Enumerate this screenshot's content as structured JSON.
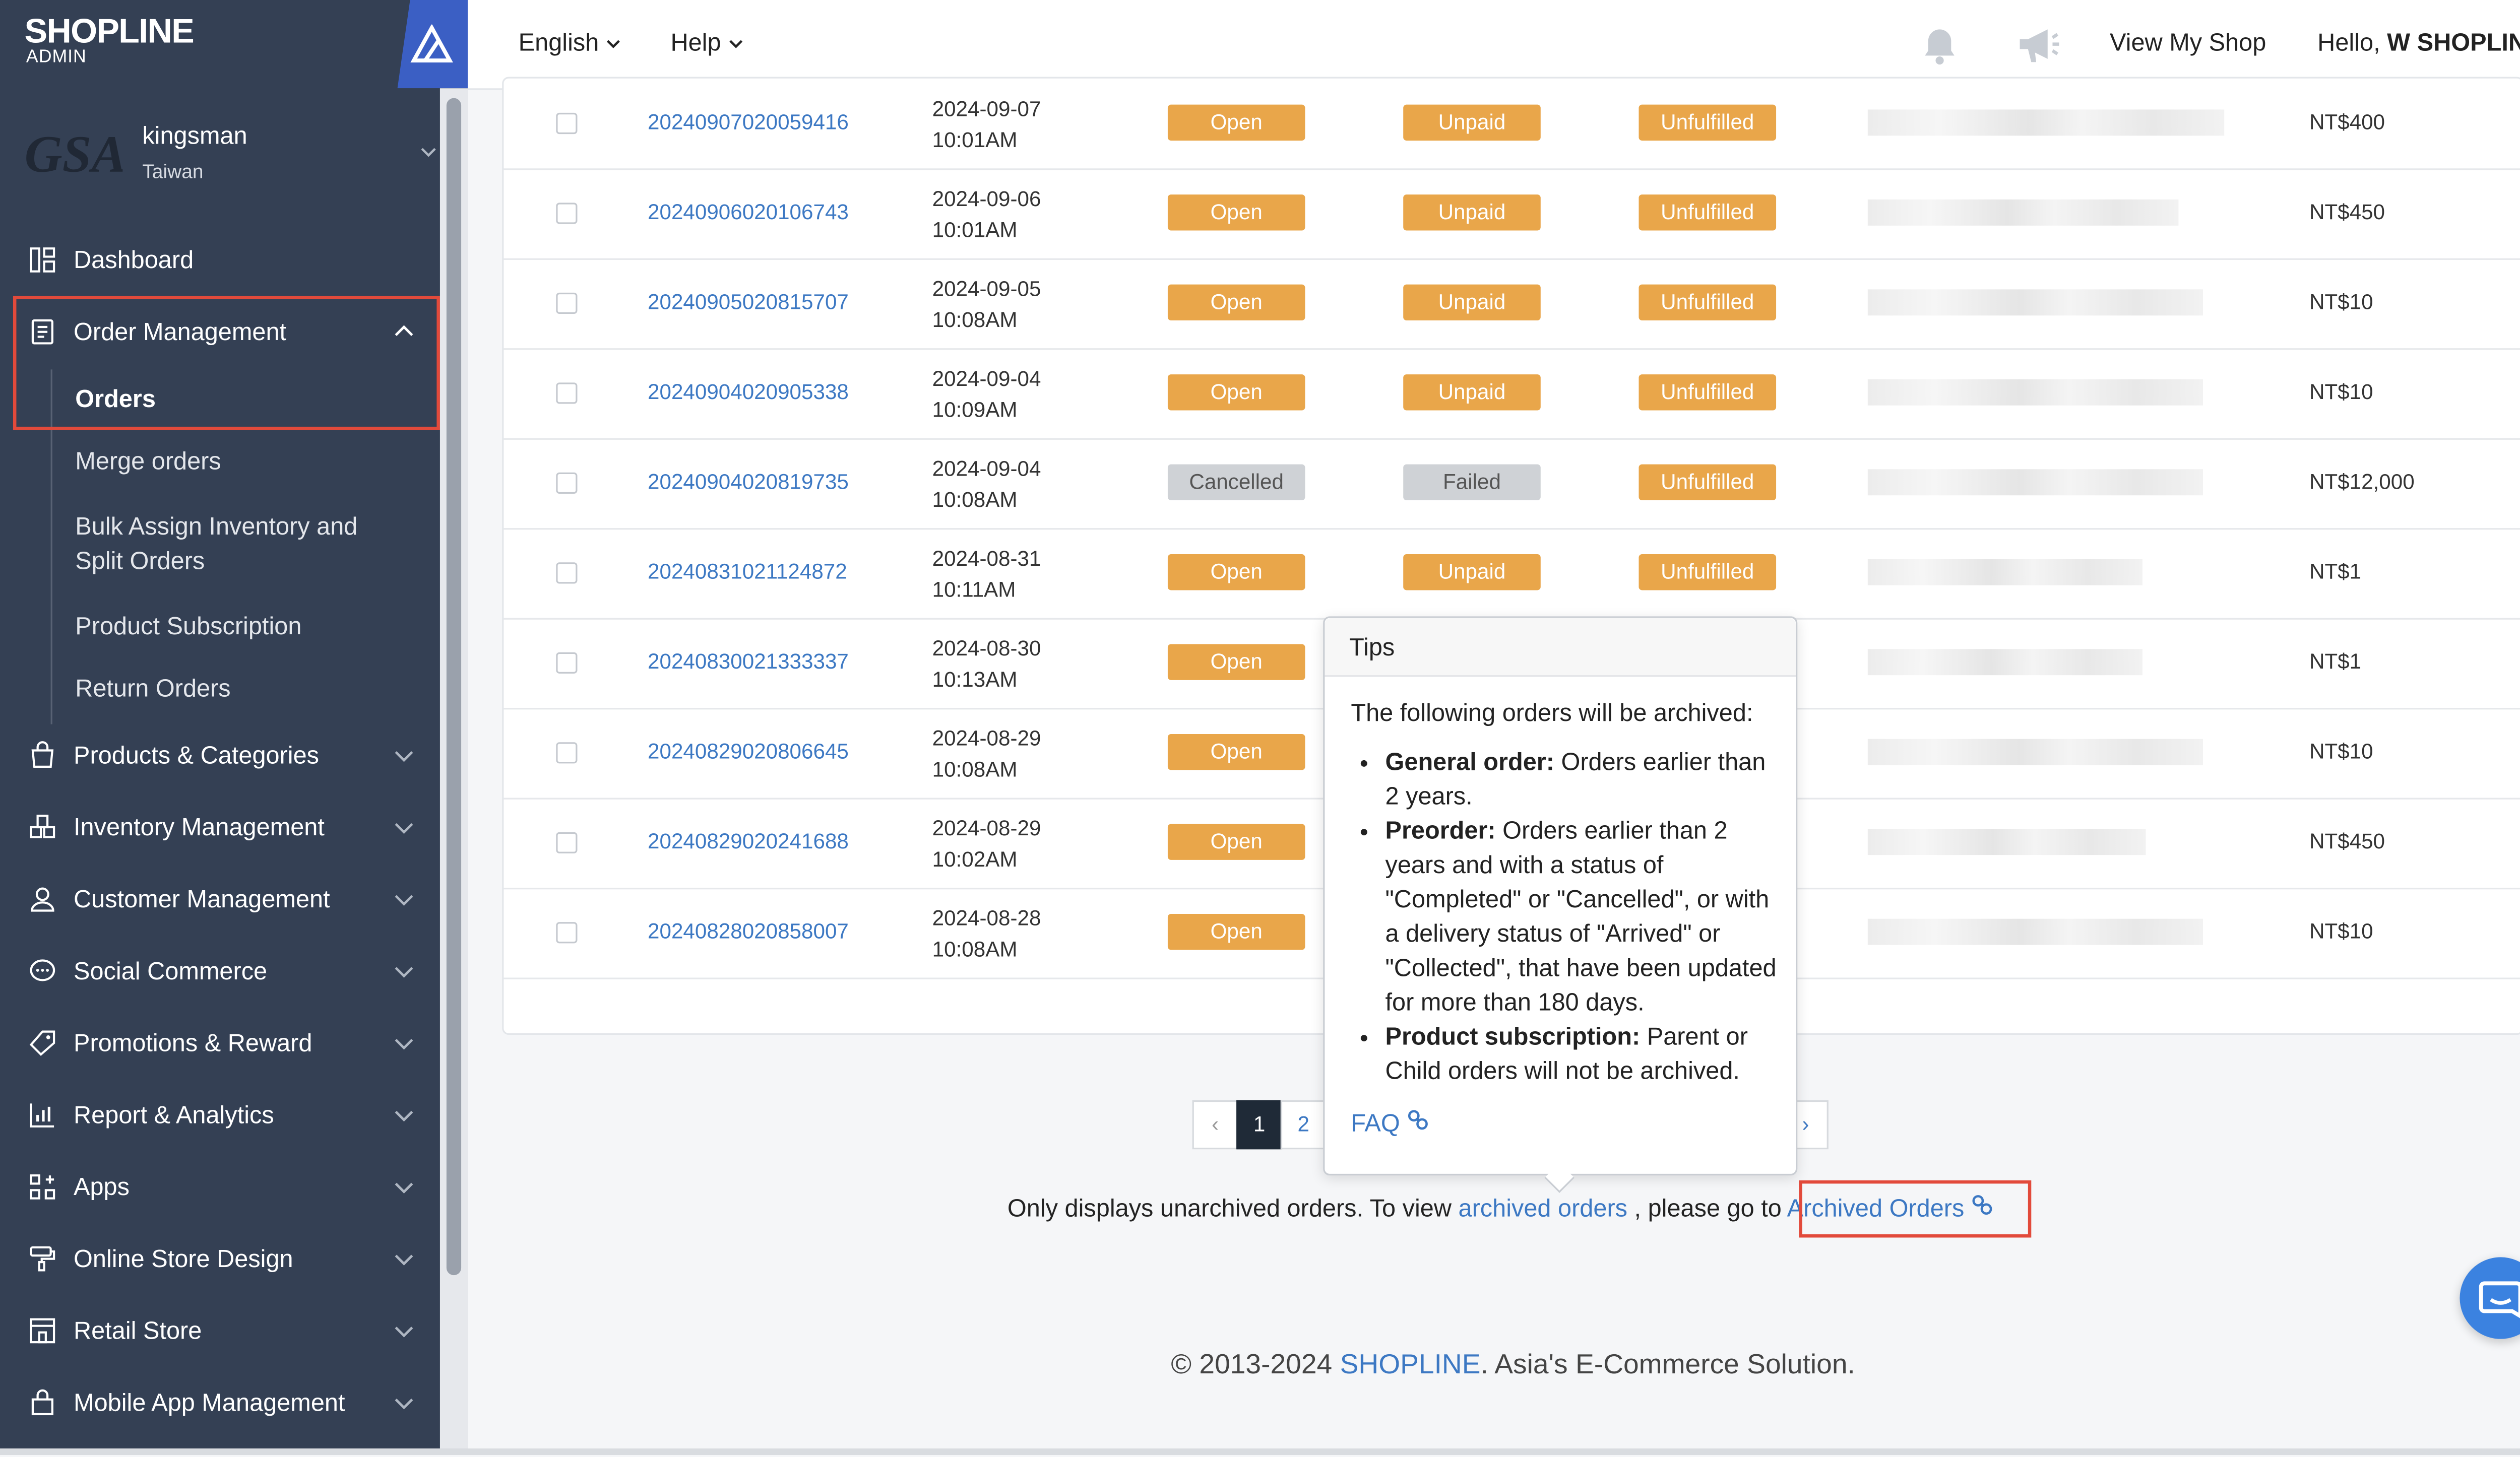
{
  "brand": {
    "logo_text": "SHOPLINE",
    "logo_sub": "ADMIN"
  },
  "store": {
    "avatar_text": "GSA",
    "name": "kingsman",
    "region": "Taiwan"
  },
  "sidebar": {
    "items": [
      {
        "label": "Dashboard"
      },
      {
        "label": "Order Management"
      },
      {
        "label": "Products & Categories"
      },
      {
        "label": "Inventory Management"
      },
      {
        "label": "Customer Management"
      },
      {
        "label": "Social Commerce"
      },
      {
        "label": "Promotions & Reward"
      },
      {
        "label": "Report & Analytics"
      },
      {
        "label": "Apps"
      },
      {
        "label": "Online Store Design"
      },
      {
        "label": "Retail Store"
      },
      {
        "label": "Mobile App Management"
      }
    ],
    "order_sub": [
      {
        "label": "Orders"
      },
      {
        "label": "Merge orders"
      },
      {
        "label": "Bulk Assign Inventory and Split Orders"
      },
      {
        "label": "Product Subscription"
      },
      {
        "label": "Return Orders"
      }
    ]
  },
  "topbar": {
    "language": "English",
    "help": "Help",
    "view_shop": "View My Shop",
    "greeting": "Hello,",
    "user": "W SHOPLINE"
  },
  "orders": [
    {
      "id": "20240907020059416",
      "date": "2024-09-07",
      "time": "10:01AM",
      "status": "Open",
      "payment": "Unpaid",
      "delivery": "Unfulfilled",
      "amount": "NT$400"
    },
    {
      "id": "20240906020106743",
      "date": "2024-09-06",
      "time": "10:01AM",
      "status": "Open",
      "payment": "Unpaid",
      "delivery": "Unfulfilled",
      "amount": "NT$450"
    },
    {
      "id": "20240905020815707",
      "date": "2024-09-05",
      "time": "10:08AM",
      "status": "Open",
      "payment": "Unpaid",
      "delivery": "Unfulfilled",
      "amount": "NT$10"
    },
    {
      "id": "20240904020905338",
      "date": "2024-09-04",
      "time": "10:09AM",
      "status": "Open",
      "payment": "Unpaid",
      "delivery": "Unfulfilled",
      "amount": "NT$10"
    },
    {
      "id": "20240904020819735",
      "date": "2024-09-04",
      "time": "10:08AM",
      "status": "Cancelled",
      "payment": "Failed",
      "delivery": "Unfulfilled",
      "amount": "NT$12,000"
    },
    {
      "id": "20240831021124872",
      "date": "2024-08-31",
      "time": "10:11AM",
      "status": "Open",
      "payment": "Unpaid",
      "delivery": "Unfulfilled",
      "amount": "NT$1"
    },
    {
      "id": "20240830021333337",
      "date": "2024-08-30",
      "time": "10:13AM",
      "status": "Open",
      "payment": "",
      "delivery": "",
      "amount": "NT$1"
    },
    {
      "id": "20240829020806645",
      "date": "2024-08-29",
      "time": "10:08AM",
      "status": "Open",
      "payment": "",
      "delivery": "",
      "amount": "NT$10"
    },
    {
      "id": "20240829020241688",
      "date": "2024-08-29",
      "time": "10:02AM",
      "status": "Open",
      "payment": "",
      "delivery": "",
      "amount": "NT$450"
    },
    {
      "id": "20240828020858007",
      "date": "2024-08-28",
      "time": "10:08AM",
      "status": "Open",
      "payment": "",
      "delivery": "",
      "amount": "NT$10"
    }
  ],
  "pagination": {
    "prev": "‹",
    "pages": [
      "1",
      "2"
    ],
    "next": "›",
    "current": "1"
  },
  "tooltip": {
    "title": "Tips",
    "intro": "The following orders will be archived:",
    "items": [
      {
        "term": "General order:",
        "text": " Orders earlier than 2 years."
      },
      {
        "term": "Preorder:",
        "text": " Orders earlier than 2 years and with a status of \"Completed\" or \"Cancelled\", or with a delivery status of \"Arrived\" or \"Collected\", that have been updated for more than 180 days."
      },
      {
        "term": "Product subscription:",
        "text": " Parent or Child orders will not be archived."
      }
    ],
    "faq": "FAQ"
  },
  "archive_note": {
    "prefix": "Only displays unarchived orders. To view ",
    "link1": "archived orders",
    "middle": " , please go to ",
    "link2": "Archived Orders"
  },
  "footer": {
    "prefix": "© 2013-2024 ",
    "brand": "SHOPLINE",
    "suffix": ". Asia's E-Commerce Solution."
  },
  "colors": {
    "sidebar_bg": "#344054",
    "accent_link": "#3c78c3",
    "badge_orange": "#e9a64a",
    "badge_grey": "#cfd2d6",
    "highlight_red": "#e24a3b",
    "chat_blue": "#3b82e0"
  }
}
